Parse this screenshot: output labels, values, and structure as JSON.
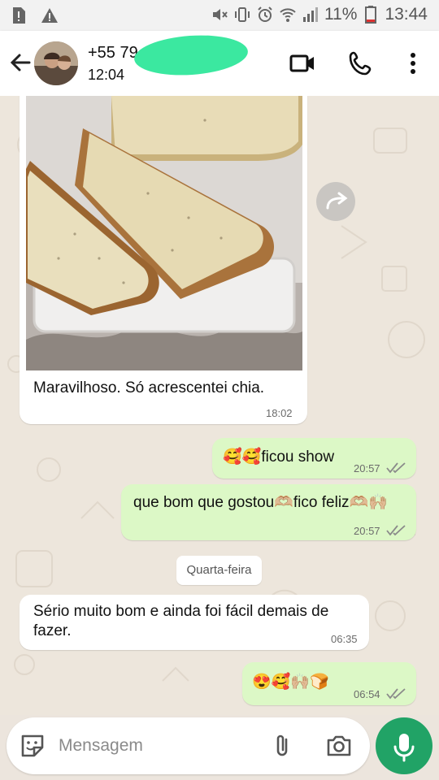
{
  "status_bar": {
    "battery": "11%",
    "time": "13:44",
    "left_icons": [
      "sim-alert-icon",
      "warning-icon"
    ],
    "right_icons": [
      "mute-icon",
      "vibrate-icon",
      "alarm-icon",
      "wifi-icon",
      "signal-icon",
      "battery-icon"
    ]
  },
  "header": {
    "contact_name": "+55 79",
    "contact_time": "12:04",
    "icons": [
      "back-arrow-icon",
      "video-call-icon",
      "phone-call-icon",
      "more-options-icon"
    ]
  },
  "messages": [
    {
      "side": "in",
      "type": "image",
      "caption": "Maravilhoso. Só acrescentei chia.",
      "time": "18:02"
    },
    {
      "side": "out",
      "text": "🥰🥰ficou show",
      "time": "20:57",
      "status": "delivered"
    },
    {
      "side": "out",
      "text": "que bom que gostou🫶🏼fico feliz🫶🏼🙌🏼",
      "time": "20:57",
      "status": "delivered"
    },
    {
      "side": "in",
      "text": "Sério muito bom e ainda foi fácil demais de fazer.",
      "time": "06:35"
    },
    {
      "side": "out",
      "text": "😍🥰🙌🏼🍞",
      "time": "06:54",
      "status": "delivered"
    }
  ],
  "day_separator": "Quarta-feira",
  "composer": {
    "placeholder": "Mensagem",
    "icons": [
      "sticker-icon",
      "attach-icon",
      "camera-icon",
      "mic-icon"
    ]
  },
  "colors": {
    "outgoing_bubble": "#dcf8c6",
    "incoming_bubble": "#ffffff",
    "chat_background": "#ede6dc",
    "accent_green": "#21a366",
    "redaction_marker": "#3be8a0"
  }
}
